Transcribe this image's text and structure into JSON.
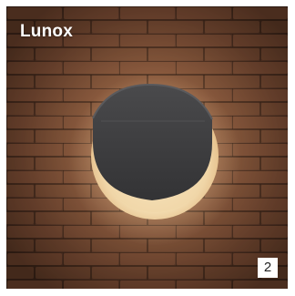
{
  "brand": {
    "name": "Lunox"
  },
  "badge": {
    "number": "2"
  },
  "photo": {
    "subject": "wall-light",
    "colors": {
      "wall_dark": "#3b2419",
      "brick": "#7a5036",
      "glow": "#f6e7c4",
      "fixture": "#3d3d3f"
    }
  }
}
